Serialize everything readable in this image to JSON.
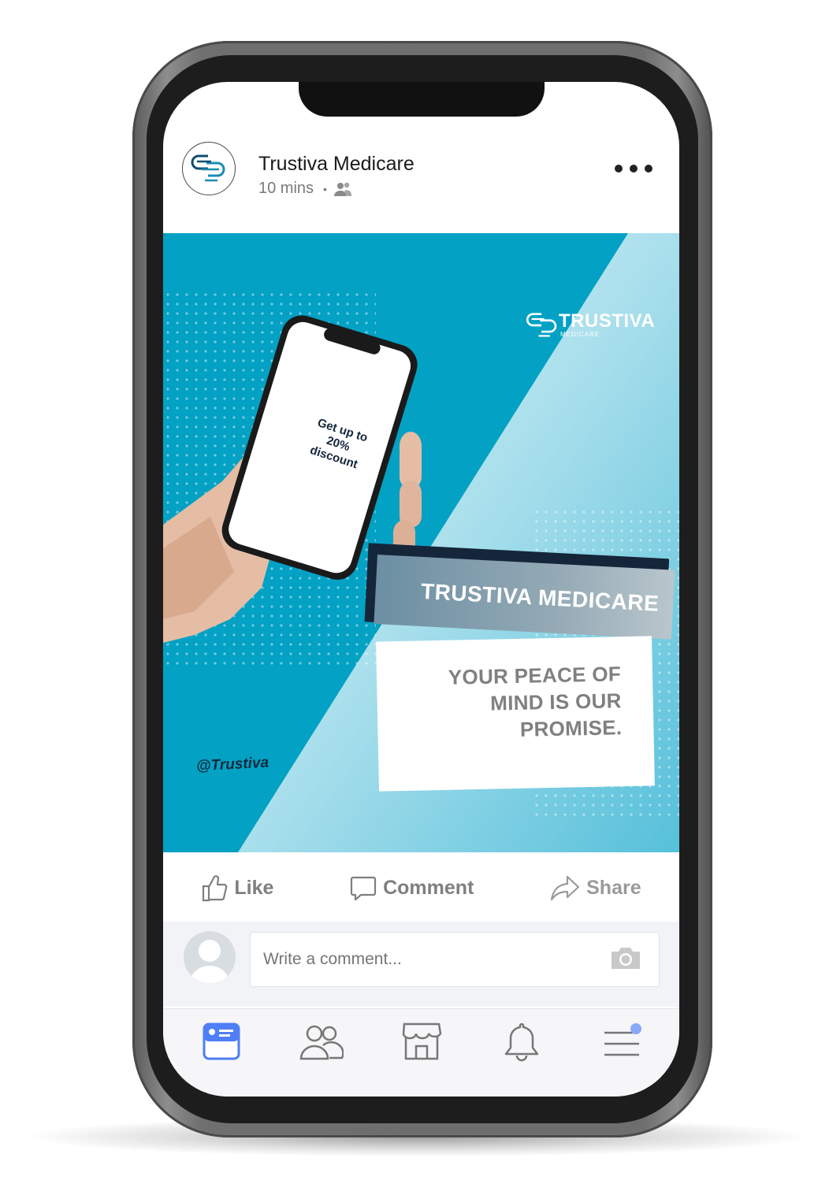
{
  "post": {
    "author": "Trustiva Medicare",
    "time": "10 mins",
    "separator": "•",
    "audience_icon": "friends-icon",
    "more_icon": "more-dots-icon"
  },
  "ad": {
    "brand_logo": "TRUSTIVA",
    "brand_logo_sub": "MEDICARE",
    "phone_screen_text": "Get up to 20% discount",
    "banner": "TRUSTIVA MEDICARE",
    "tagline_lines": [
      "YOUR PEACE OF",
      "MIND IS OUR",
      "PROMISE."
    ],
    "handle": "@Trustiva",
    "colors": {
      "background": "#03a1c4",
      "light_panel": "#bfe7f1",
      "banner_dark": "#15263a",
      "tagline": "#808080"
    }
  },
  "actions": {
    "like": "Like",
    "comment": "Comment",
    "share": "Share"
  },
  "comment_box": {
    "placeholder": "Write a comment...",
    "camera_icon": "camera-icon"
  },
  "nav": {
    "items": [
      {
        "icon": "news-feed-icon",
        "active": true
      },
      {
        "icon": "friends-icon",
        "active": false
      },
      {
        "icon": "marketplace-icon",
        "active": false
      },
      {
        "icon": "bell-icon",
        "active": false
      },
      {
        "icon": "menu-icon",
        "active": false,
        "badge": true
      }
    ],
    "accent": "#4f7ef7"
  }
}
